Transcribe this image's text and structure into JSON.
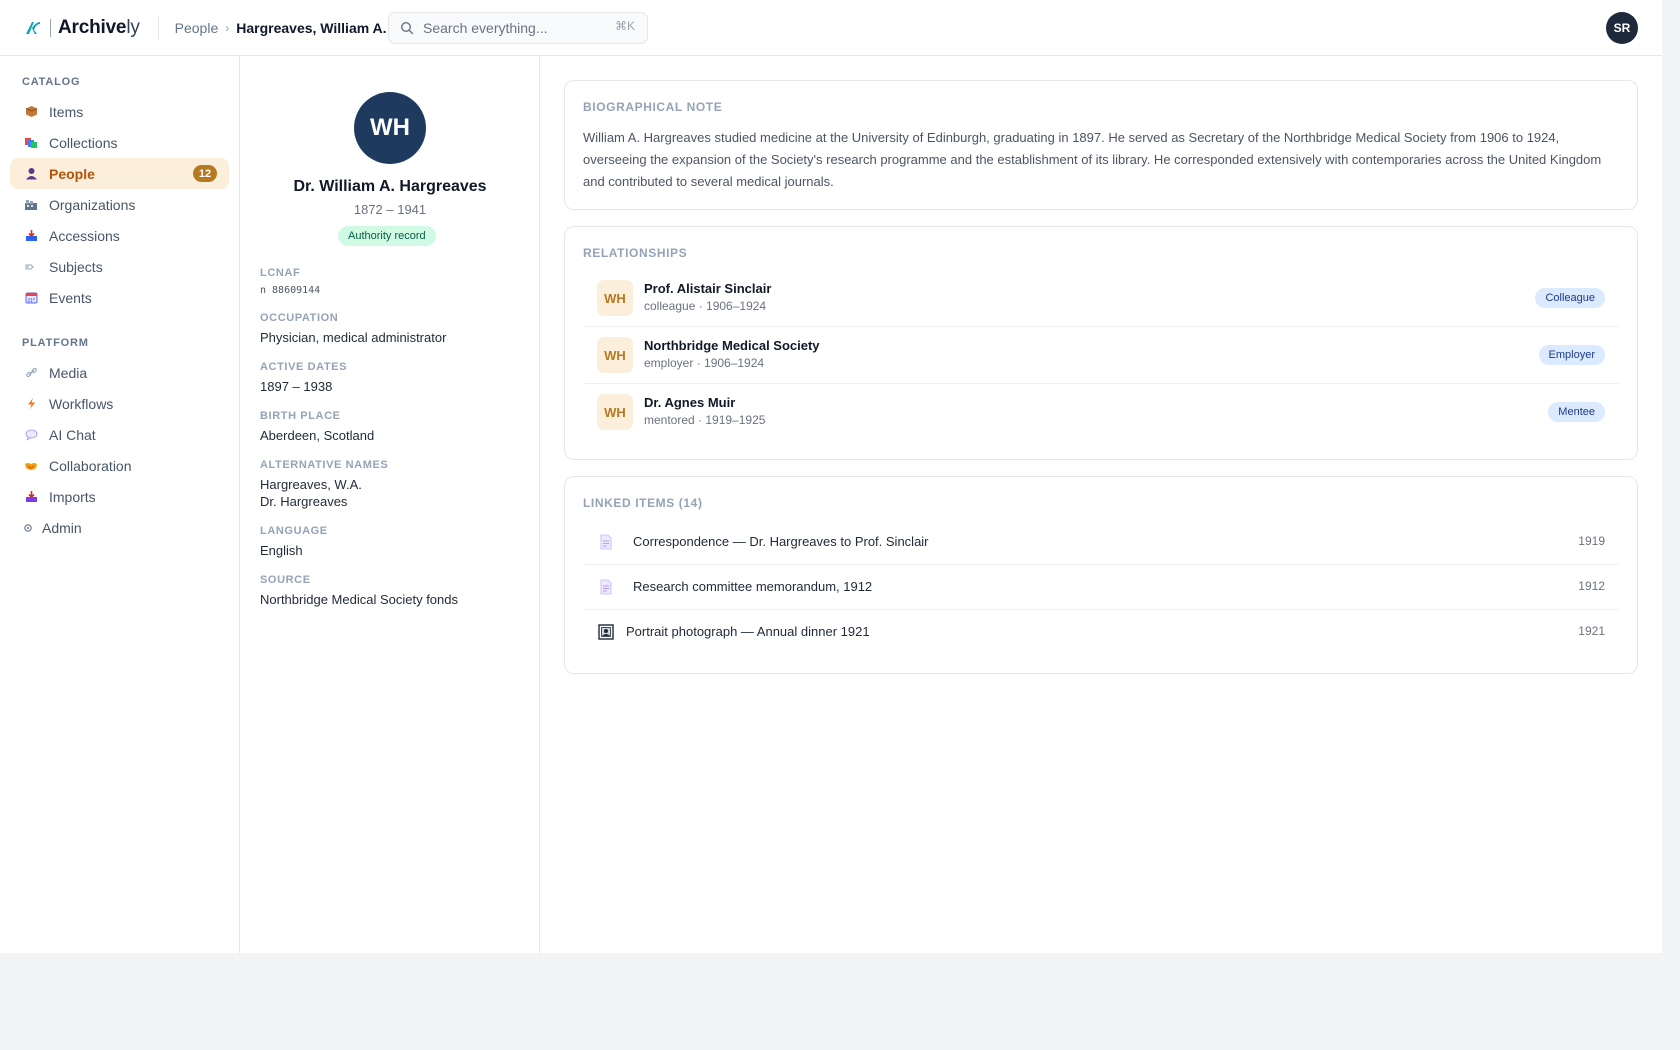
{
  "app": {
    "brand_bold": "Archive",
    "brand_light": "ly"
  },
  "breadcrumb": {
    "parent": "People",
    "separator": "›",
    "current": "Hargreaves, William A."
  },
  "search": {
    "placeholder": "Search everything...",
    "shortcut": "⌘K"
  },
  "user": {
    "initials": "SR"
  },
  "sidebar": {
    "catalog_label": "CATALOG",
    "catalog_items": [
      {
        "label": "Items",
        "icon": "box-icon"
      },
      {
        "label": "Collections",
        "icon": "collections-icon"
      },
      {
        "label": "People",
        "icon": "person-icon",
        "badge": "12",
        "active": true
      },
      {
        "label": "Organizations",
        "icon": "building-icon"
      },
      {
        "label": "Accessions",
        "icon": "inbox-icon"
      },
      {
        "label": "Subjects",
        "icon": "tag-icon"
      },
      {
        "label": "Events",
        "icon": "calendar-icon"
      }
    ],
    "platform_label": "PLATFORM",
    "platform_items": [
      {
        "label": "Media",
        "icon": "link-icon"
      },
      {
        "label": "Workflows",
        "icon": "lightning-icon"
      },
      {
        "label": "AI Chat",
        "icon": "chat-icon"
      },
      {
        "label": "Collaboration",
        "icon": "handshake-icon"
      },
      {
        "label": "Imports",
        "icon": "import-icon"
      },
      {
        "label": "Admin",
        "icon": "gear-icon"
      }
    ]
  },
  "profile": {
    "initials": "WH",
    "name": "Dr. William A. Hargreaves",
    "dates": "1872 – 1941",
    "badge": "Authority record",
    "fields": {
      "lcnaf_label": "LCNAF",
      "lcnaf_value": "n 88609144",
      "occupation_label": "OCCUPATION",
      "occupation_value": "Physician, medical administrator",
      "active_label": "ACTIVE DATES",
      "active_value": "1897 – 1938",
      "birthplace_label": "BIRTH PLACE",
      "birthplace_value": "Aberdeen, Scotland",
      "altnames_label": "ALTERNATIVE NAMES",
      "altnames_values": [
        "Hargreaves, W.A.",
        "Dr. Hargreaves"
      ],
      "language_label": "LANGUAGE",
      "language_value": "English",
      "source_label": "SOURCE",
      "source_value": "Northbridge Medical Society fonds"
    }
  },
  "bio": {
    "title": "BIOGRAPHICAL NOTE",
    "text": "William A. Hargreaves studied medicine at the University of Edinburgh, graduating in 1897. He served as Secretary of the Northbridge Medical Society from 1906 to 1924, overseeing the expansion of the Society's research programme and the establishment of its library. He corresponded extensively with contemporaries across the United Kingdom and contributed to several medical journals."
  },
  "relationships": {
    "title": "RELATIONSHIPS",
    "items": [
      {
        "initials": "WH",
        "name": "Prof. Alistair Sinclair",
        "meta": "colleague · 1906–1924",
        "tag": "Colleague"
      },
      {
        "initials": "WH",
        "name": "Northbridge Medical Society",
        "meta": "employer · 1906–1924",
        "tag": "Employer"
      },
      {
        "initials": "WH",
        "name": "Dr. Agnes Muir",
        "meta": "mentored · 1919–1925",
        "tag": "Mentee"
      }
    ]
  },
  "linked": {
    "title": "LINKED ITEMS (14)",
    "items": [
      {
        "icon": "document-icon",
        "title": "Correspondence — Dr. Hargreaves to Prof. Sinclair",
        "year": "1919"
      },
      {
        "icon": "document-icon",
        "title": "Research committee memorandum, 1912",
        "year": "1912"
      },
      {
        "icon": "picture-icon",
        "title": "Portrait photograph — Annual dinner 1921",
        "year": "1921"
      }
    ]
  },
  "colors": {
    "accent": "#b7791f",
    "active_bg": "#fbefdc",
    "navy": "#1e3a5f"
  }
}
